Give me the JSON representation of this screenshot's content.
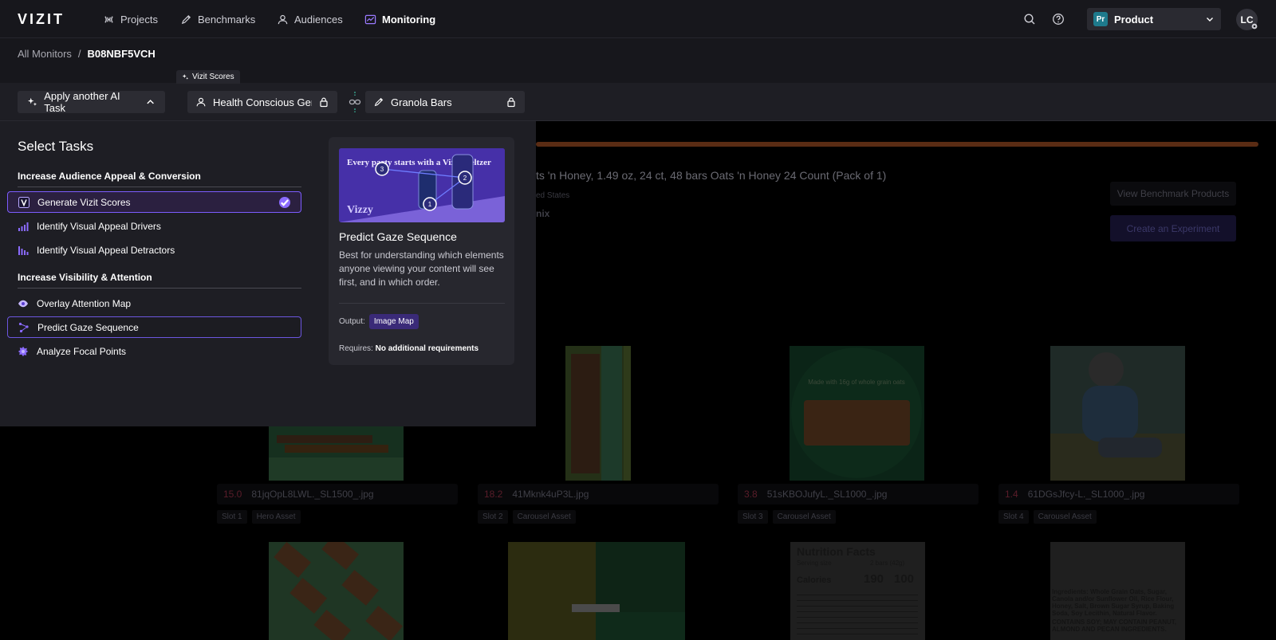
{
  "nav": {
    "logo": "VIZIT",
    "items": [
      {
        "label": "Projects",
        "icon": "projects-icon"
      },
      {
        "label": "Benchmarks",
        "icon": "pencil-icon"
      },
      {
        "label": "Audiences",
        "icon": "user-icon"
      },
      {
        "label": "Monitoring",
        "icon": "chart-icon",
        "active": true
      }
    ],
    "product": {
      "badge": "Pr",
      "label": "Product"
    },
    "avatar": "LC"
  },
  "breadcrumb": {
    "root": "All Monitors",
    "separator": "/",
    "current": "B08NBF5VCH"
  },
  "toolbar": {
    "apply_label": "Apply another AI Task",
    "scores_tab": "Vizit Scores",
    "audience": "Health Conscious Gen ...",
    "category": "Granola Bars"
  },
  "panel": {
    "title": "Select Tasks",
    "sections": [
      {
        "heading": "Increase Audience Appeal & Conversion"
      },
      {
        "heading": "Increase Visibility & Attention"
      }
    ],
    "tasks": [
      {
        "label": "Generate Vizit Scores",
        "icon": "vizit-v-icon",
        "state": "selected"
      },
      {
        "label": "Identify Visual Appeal Drivers",
        "icon": "bars-up-icon"
      },
      {
        "label": "Identify Visual Appeal Detractors",
        "icon": "bars-down-icon"
      },
      {
        "label": "Overlay Attention Map",
        "icon": "eye-icon"
      },
      {
        "label": "Predict Gaze Sequence",
        "icon": "gaze-sequence-icon",
        "state": "hover"
      },
      {
        "label": "Analyze Focal Points",
        "icon": "focal-point-icon"
      }
    ],
    "detail": {
      "preview_text": "Every party starts with a Vizzy Seltzer",
      "preview_brand": "Vizzy",
      "gaze_points": [
        "1",
        "2",
        "3"
      ],
      "title": "Predict Gaze Sequence",
      "description": "Best for understanding which elements anyone viewing your content will see first, and in which order.",
      "output_label": "Output:",
      "output_value": "Image Map",
      "requires_label": "Requires:",
      "requires_value": "No additional requirements"
    }
  },
  "background": {
    "title": "ts 'n Honey, 1.49 oz, 24 ct, 48 bars Oats 'n Honey 24 Count (Pack of 1)",
    "subtitle": "ed States",
    "subtitle2": "nix",
    "view_benchmark": "View Benchmark Products",
    "create_experiment": "Create an Experiment",
    "cards": [
      {
        "score": "15.0",
        "file": "81jqOpL8LWL._SL1500_.jpg",
        "slot": "Slot 1",
        "type": "Hero Asset"
      },
      {
        "score": "18.2",
        "file": "41Mknk4uP3L.jpg",
        "slot": "Slot 2",
        "type": "Carousel Asset"
      },
      {
        "score": "3.8",
        "file": "51sKBOJufyL._SL1000_.jpg",
        "slot": "Slot 3",
        "type": "Carousel Asset"
      },
      {
        "score": "1.4",
        "file": "61DGsJfcy-L._SL1000_.jpg",
        "slot": "Slot 4",
        "type": "Carousel Asset"
      }
    ],
    "thumb_text": {
      "oats": "Made with 16g of whole grain oats",
      "nutrition_title": "Nutrition Facts",
      "nutrition_serving": "Serving size",
      "nutrition_serving_value": "2 bars (42g)",
      "nutrition_calories": "Calories",
      "nutrition_cal_values": [
        "190",
        "100"
      ],
      "ingredients": "Ingredients: Whole Grain Oats, Sugar, Canola and/or Sunflower Oil, Rice Flour, Honey, Salt, Brown Sugar Syrup, Baking Soda, Soy Lecithin, Natural Flavor.",
      "allergen": "CONTAINS SOY; MAY CONTAIN PEANUT, ALMOND AND PECAN INGREDIENTS."
    }
  }
}
